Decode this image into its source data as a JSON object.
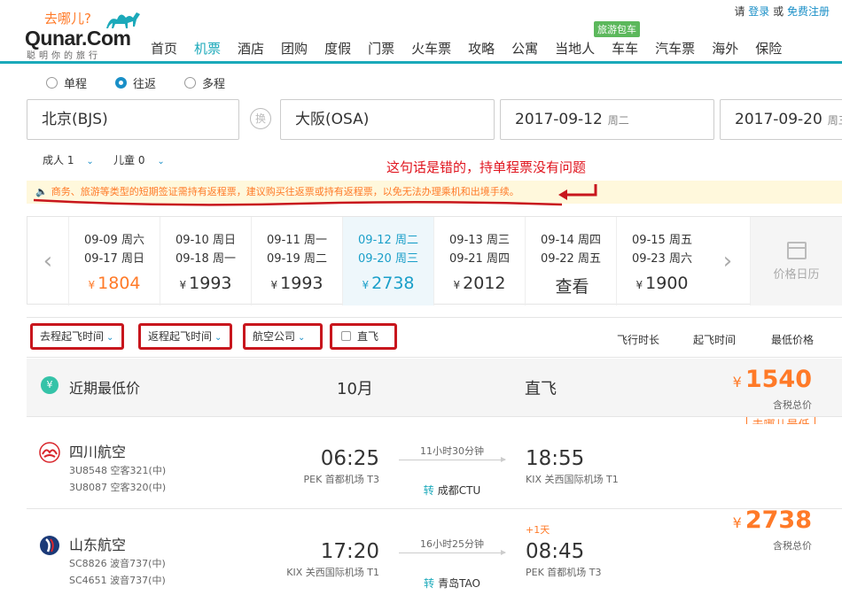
{
  "header": {
    "slogan_cn": "去哪儿?",
    "logo_text": "Qunar.Com",
    "logo_sub": "聪明你的旅行",
    "top_links": {
      "prefix": "请",
      "login": "登录",
      "or": "或",
      "register": "免费注册"
    },
    "nav_badge": "旅游包车",
    "nav_items": [
      "首页",
      "机票",
      "酒店",
      "团购",
      "度假",
      "门票",
      "火车票",
      "攻略",
      "公寓",
      "当地人",
      "车车",
      "汽车票",
      "海外",
      "保险"
    ],
    "nav_active": "机票"
  },
  "search": {
    "trip_types": [
      "单程",
      "往返",
      "多程"
    ],
    "trip_selected": "往返",
    "from": "北京(BJS)",
    "swap_label": "换",
    "to": "大阪(OSA)",
    "depart_date": "2017-09-12",
    "depart_weekday": "周二",
    "return_date": "2017-09-20",
    "return_weekday": "周三",
    "adult_label": "成人",
    "adult_count": "1",
    "child_label": "儿童",
    "child_count": "0"
  },
  "annotation": {
    "text": "这句话是错的，持单程票没有问题",
    "color": "#e0141e"
  },
  "warning": "商务、旅游等类型的短期签证需持有返程票，建议购买往返票或持有返程票，以免无法办理乘机和出境手续。",
  "date_strip": {
    "cells": [
      {
        "d1": "09-09 周六",
        "d2": "09-17 周日",
        "currency": "¥",
        "price": "1804",
        "style": "orange"
      },
      {
        "d1": "09-10 周日",
        "d2": "09-18 周一",
        "currency": "¥",
        "price": "1993",
        "style": "normal"
      },
      {
        "d1": "09-11 周一",
        "d2": "09-19 周二",
        "currency": "¥",
        "price": "1993",
        "style": "normal"
      },
      {
        "d1": "09-12 周二",
        "d2": "09-20 周三",
        "currency": "¥",
        "price": "2738",
        "style": "selected"
      },
      {
        "d1": "09-13 周三",
        "d2": "09-21 周四",
        "currency": "¥",
        "price": "2012",
        "style": "normal"
      },
      {
        "d1": "09-14 周四",
        "d2": "09-22 周五",
        "currency": "",
        "price": "查看",
        "style": "normal"
      },
      {
        "d1": "09-15 周五",
        "d2": "09-23 周六",
        "currency": "¥",
        "price": "1900",
        "style": "normal"
      }
    ],
    "calendar_label": "价格日历"
  },
  "filters": {
    "depart_time": "去程起飞时间",
    "return_time": "返程起飞时间",
    "airline": "航空公司",
    "direct": "直飞",
    "sort_duration": "飞行时长",
    "sort_depart": "起飞时间",
    "sort_price": "最低价格"
  },
  "summary": {
    "label": "近期最低价",
    "month": "10月",
    "direct": "直飞",
    "currency": "¥",
    "price": "1540",
    "tax_note": "含税总价",
    "lowest_tag": "去哪儿最低"
  },
  "flights": [
    {
      "airline": "四川航空",
      "flight_numbers": [
        "3U8548 空客321(中)",
        "3U8087 空客320(中)"
      ],
      "dep_time": "06:25",
      "dep_airport": "PEK 首都机场 T3",
      "duration": "11小时30分钟",
      "transfer_tag": "转",
      "transfer_city": "成都CTU",
      "arr_time": "18:55",
      "arr_airport": "KIX 关西国际机场 T1",
      "plus_day": "",
      "currency": "",
      "price": "",
      "tax_note": ""
    },
    {
      "airline": "山东航空",
      "flight_numbers": [
        "SC8826 波音737(中)",
        "SC4651 波音737(中)"
      ],
      "dep_time": "17:20",
      "dep_airport": "KIX 关西国际机场 T1",
      "duration": "16小时25分钟",
      "transfer_tag": "转",
      "transfer_city": "青岛TAO",
      "arr_time": "08:45",
      "arr_airport": "PEK 首都机场 T3",
      "plus_day": "+1天",
      "currency": "¥",
      "price": "2738",
      "tax_note": "含税总价"
    }
  ],
  "colors": {
    "accent": "#1ba9ba",
    "price": "#ff7a28",
    "link": "#1a8fc7",
    "annotation": "#c8161d"
  }
}
